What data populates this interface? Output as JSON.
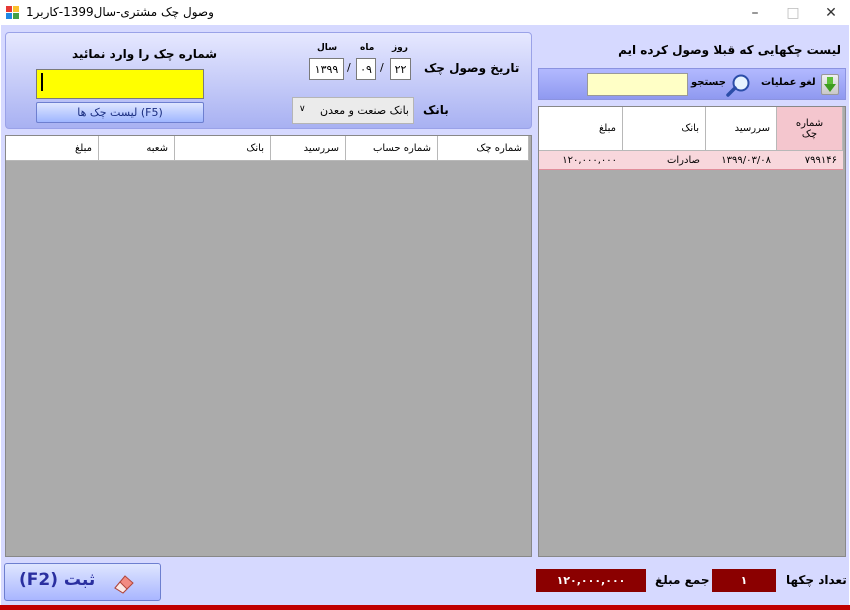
{
  "window": {
    "title": "وصول چک مشتری-سال1399-کاربر1"
  },
  "receive_panel": {
    "date_label": "تاریخ وصول چک",
    "day_label": "روز",
    "month_label": "ماه",
    "year_label": "سال",
    "day": "۲۲",
    "month": "۰۹",
    "year": "۱۳۹۹",
    "separator": "/",
    "bank_label": "بانک",
    "bank_selected": "بانک صنعت و معدن",
    "check_no_label": "شماره چک را وارد نمائید",
    "check_no_value": "",
    "check_list_button": "لیست چک ها  (F5)"
  },
  "left_grid": {
    "columns": [
      "شماره چک",
      "شماره حساب",
      "سررسید",
      "بانک",
      "شعبه",
      "مبلغ"
    ]
  },
  "right_panel": {
    "title": "لیست چکهایی که قبلا وصول کرده ایم",
    "cancel_label": "لغو عملیات",
    "search_label": "جستجو",
    "search_value": "",
    "columns": [
      "شماره\nچک",
      "سررسید",
      "بانک",
      "مبلغ"
    ],
    "rows": [
      {
        "check_no": "۷۹۹۱۴۶",
        "due": "۱۳۹۹/۰۳/۰۸",
        "bank": "صادرات",
        "amount": "۱۲۰,۰۰۰,۰۰۰"
      }
    ]
  },
  "footer": {
    "save_label": "ثبت (F2)",
    "count_label": "تعداد چکها",
    "count_value": "۱",
    "sum_label": "جمع مبلغ",
    "sum_value": "۱۲۰,۰۰۰,۰۰۰"
  },
  "colors": {
    "accent": "#a8b1f2",
    "total": "#8b0000",
    "selected_row": "#f8d7dc",
    "input_highlight": "#ffff00"
  }
}
